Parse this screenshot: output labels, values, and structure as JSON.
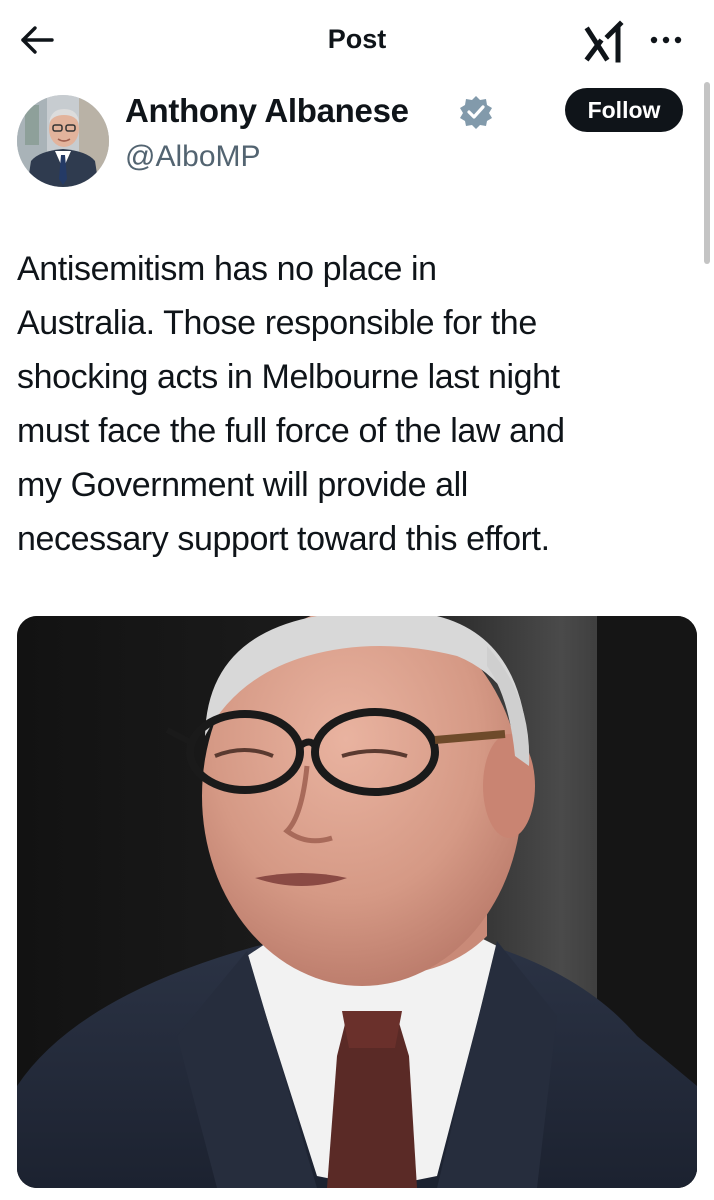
{
  "header": {
    "back_icon": "arrow-left-icon",
    "title": "Post",
    "grok_icon": "grok-icon",
    "more_icon": "more-dots-icon"
  },
  "author": {
    "name": "Anthony Albanese",
    "handle": "@AlboMP",
    "verified_icon": "verified-badge-icon",
    "verified_color": "#829aab",
    "follow_label": "Follow"
  },
  "post": {
    "text": "Antisemitism has no place in\nAustralia. Those responsible for the\nshocking acts in Melbourne last night\nmust face the full force of the law and\nmy Government will provide all\nnecessary support toward this effort."
  },
  "colors": {
    "text_primary": "#0f1419",
    "text_secondary": "#536471",
    "follow_bg": "#0f1419",
    "follow_text": "#ffffff"
  }
}
